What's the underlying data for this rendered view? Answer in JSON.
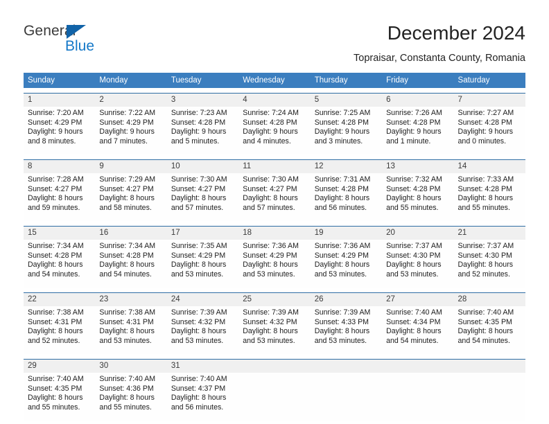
{
  "logo": {
    "primary_text": "General",
    "secondary_text": "Blue",
    "primary_color": "#3a3a3a",
    "secondary_color": "#1478c8",
    "triangle_color": "#1163a8"
  },
  "header": {
    "title": "December 2024",
    "subtitle": "Topraisar, Constanta County, Romania"
  },
  "theme": {
    "header_row_bg": "#3b7ebf",
    "header_row_text": "#ffffff",
    "week_divider": "#2e6da4",
    "day_number_bg": "#f0f0f0",
    "cell_bg": "#fefefe"
  },
  "weekday_headers": [
    "Sunday",
    "Monday",
    "Tuesday",
    "Wednesday",
    "Thursday",
    "Friday",
    "Saturday"
  ],
  "weeks": [
    {
      "days": [
        {
          "number": "1",
          "sunrise": "Sunrise: 7:20 AM",
          "sunset": "Sunset: 4:29 PM",
          "daylight_line1": "Daylight: 9 hours",
          "daylight_line2": "and 8 minutes."
        },
        {
          "number": "2",
          "sunrise": "Sunrise: 7:22 AM",
          "sunset": "Sunset: 4:29 PM",
          "daylight_line1": "Daylight: 9 hours",
          "daylight_line2": "and 7 minutes."
        },
        {
          "number": "3",
          "sunrise": "Sunrise: 7:23 AM",
          "sunset": "Sunset: 4:28 PM",
          "daylight_line1": "Daylight: 9 hours",
          "daylight_line2": "and 5 minutes."
        },
        {
          "number": "4",
          "sunrise": "Sunrise: 7:24 AM",
          "sunset": "Sunset: 4:28 PM",
          "daylight_line1": "Daylight: 9 hours",
          "daylight_line2": "and 4 minutes."
        },
        {
          "number": "5",
          "sunrise": "Sunrise: 7:25 AM",
          "sunset": "Sunset: 4:28 PM",
          "daylight_line1": "Daylight: 9 hours",
          "daylight_line2": "and 3 minutes."
        },
        {
          "number": "6",
          "sunrise": "Sunrise: 7:26 AM",
          "sunset": "Sunset: 4:28 PM",
          "daylight_line1": "Daylight: 9 hours",
          "daylight_line2": "and 1 minute."
        },
        {
          "number": "7",
          "sunrise": "Sunrise: 7:27 AM",
          "sunset": "Sunset: 4:28 PM",
          "daylight_line1": "Daylight: 9 hours",
          "daylight_line2": "and 0 minutes."
        }
      ]
    },
    {
      "days": [
        {
          "number": "8",
          "sunrise": "Sunrise: 7:28 AM",
          "sunset": "Sunset: 4:27 PM",
          "daylight_line1": "Daylight: 8 hours",
          "daylight_line2": "and 59 minutes."
        },
        {
          "number": "9",
          "sunrise": "Sunrise: 7:29 AM",
          "sunset": "Sunset: 4:27 PM",
          "daylight_line1": "Daylight: 8 hours",
          "daylight_line2": "and 58 minutes."
        },
        {
          "number": "10",
          "sunrise": "Sunrise: 7:30 AM",
          "sunset": "Sunset: 4:27 PM",
          "daylight_line1": "Daylight: 8 hours",
          "daylight_line2": "and 57 minutes."
        },
        {
          "number": "11",
          "sunrise": "Sunrise: 7:30 AM",
          "sunset": "Sunset: 4:27 PM",
          "daylight_line1": "Daylight: 8 hours",
          "daylight_line2": "and 57 minutes."
        },
        {
          "number": "12",
          "sunrise": "Sunrise: 7:31 AM",
          "sunset": "Sunset: 4:28 PM",
          "daylight_line1": "Daylight: 8 hours",
          "daylight_line2": "and 56 minutes."
        },
        {
          "number": "13",
          "sunrise": "Sunrise: 7:32 AM",
          "sunset": "Sunset: 4:28 PM",
          "daylight_line1": "Daylight: 8 hours",
          "daylight_line2": "and 55 minutes."
        },
        {
          "number": "14",
          "sunrise": "Sunrise: 7:33 AM",
          "sunset": "Sunset: 4:28 PM",
          "daylight_line1": "Daylight: 8 hours",
          "daylight_line2": "and 55 minutes."
        }
      ]
    },
    {
      "days": [
        {
          "number": "15",
          "sunrise": "Sunrise: 7:34 AM",
          "sunset": "Sunset: 4:28 PM",
          "daylight_line1": "Daylight: 8 hours",
          "daylight_line2": "and 54 minutes."
        },
        {
          "number": "16",
          "sunrise": "Sunrise: 7:34 AM",
          "sunset": "Sunset: 4:28 PM",
          "daylight_line1": "Daylight: 8 hours",
          "daylight_line2": "and 54 minutes."
        },
        {
          "number": "17",
          "sunrise": "Sunrise: 7:35 AM",
          "sunset": "Sunset: 4:29 PM",
          "daylight_line1": "Daylight: 8 hours",
          "daylight_line2": "and 53 minutes."
        },
        {
          "number": "18",
          "sunrise": "Sunrise: 7:36 AM",
          "sunset": "Sunset: 4:29 PM",
          "daylight_line1": "Daylight: 8 hours",
          "daylight_line2": "and 53 minutes."
        },
        {
          "number": "19",
          "sunrise": "Sunrise: 7:36 AM",
          "sunset": "Sunset: 4:29 PM",
          "daylight_line1": "Daylight: 8 hours",
          "daylight_line2": "and 53 minutes."
        },
        {
          "number": "20",
          "sunrise": "Sunrise: 7:37 AM",
          "sunset": "Sunset: 4:30 PM",
          "daylight_line1": "Daylight: 8 hours",
          "daylight_line2": "and 53 minutes."
        },
        {
          "number": "21",
          "sunrise": "Sunrise: 7:37 AM",
          "sunset": "Sunset: 4:30 PM",
          "daylight_line1": "Daylight: 8 hours",
          "daylight_line2": "and 52 minutes."
        }
      ]
    },
    {
      "days": [
        {
          "number": "22",
          "sunrise": "Sunrise: 7:38 AM",
          "sunset": "Sunset: 4:31 PM",
          "daylight_line1": "Daylight: 8 hours",
          "daylight_line2": "and 52 minutes."
        },
        {
          "number": "23",
          "sunrise": "Sunrise: 7:38 AM",
          "sunset": "Sunset: 4:31 PM",
          "daylight_line1": "Daylight: 8 hours",
          "daylight_line2": "and 53 minutes."
        },
        {
          "number": "24",
          "sunrise": "Sunrise: 7:39 AM",
          "sunset": "Sunset: 4:32 PM",
          "daylight_line1": "Daylight: 8 hours",
          "daylight_line2": "and 53 minutes."
        },
        {
          "number": "25",
          "sunrise": "Sunrise: 7:39 AM",
          "sunset": "Sunset: 4:32 PM",
          "daylight_line1": "Daylight: 8 hours",
          "daylight_line2": "and 53 minutes."
        },
        {
          "number": "26",
          "sunrise": "Sunrise: 7:39 AM",
          "sunset": "Sunset: 4:33 PM",
          "daylight_line1": "Daylight: 8 hours",
          "daylight_line2": "and 53 minutes."
        },
        {
          "number": "27",
          "sunrise": "Sunrise: 7:40 AM",
          "sunset": "Sunset: 4:34 PM",
          "daylight_line1": "Daylight: 8 hours",
          "daylight_line2": "and 54 minutes."
        },
        {
          "number": "28",
          "sunrise": "Sunrise: 7:40 AM",
          "sunset": "Sunset: 4:35 PM",
          "daylight_line1": "Daylight: 8 hours",
          "daylight_line2": "and 54 minutes."
        }
      ]
    },
    {
      "days": [
        {
          "number": "29",
          "sunrise": "Sunrise: 7:40 AM",
          "sunset": "Sunset: 4:35 PM",
          "daylight_line1": "Daylight: 8 hours",
          "daylight_line2": "and 55 minutes."
        },
        {
          "number": "30",
          "sunrise": "Sunrise: 7:40 AM",
          "sunset": "Sunset: 4:36 PM",
          "daylight_line1": "Daylight: 8 hours",
          "daylight_line2": "and 55 minutes."
        },
        {
          "number": "31",
          "sunrise": "Sunrise: 7:40 AM",
          "sunset": "Sunset: 4:37 PM",
          "daylight_line1": "Daylight: 8 hours",
          "daylight_line2": "and 56 minutes."
        },
        {
          "number": "",
          "sunrise": "",
          "sunset": "",
          "daylight_line1": "",
          "daylight_line2": ""
        },
        {
          "number": "",
          "sunrise": "",
          "sunset": "",
          "daylight_line1": "",
          "daylight_line2": ""
        },
        {
          "number": "",
          "sunrise": "",
          "sunset": "",
          "daylight_line1": "",
          "daylight_line2": ""
        },
        {
          "number": "",
          "sunrise": "",
          "sunset": "",
          "daylight_line1": "",
          "daylight_line2": ""
        }
      ]
    }
  ]
}
